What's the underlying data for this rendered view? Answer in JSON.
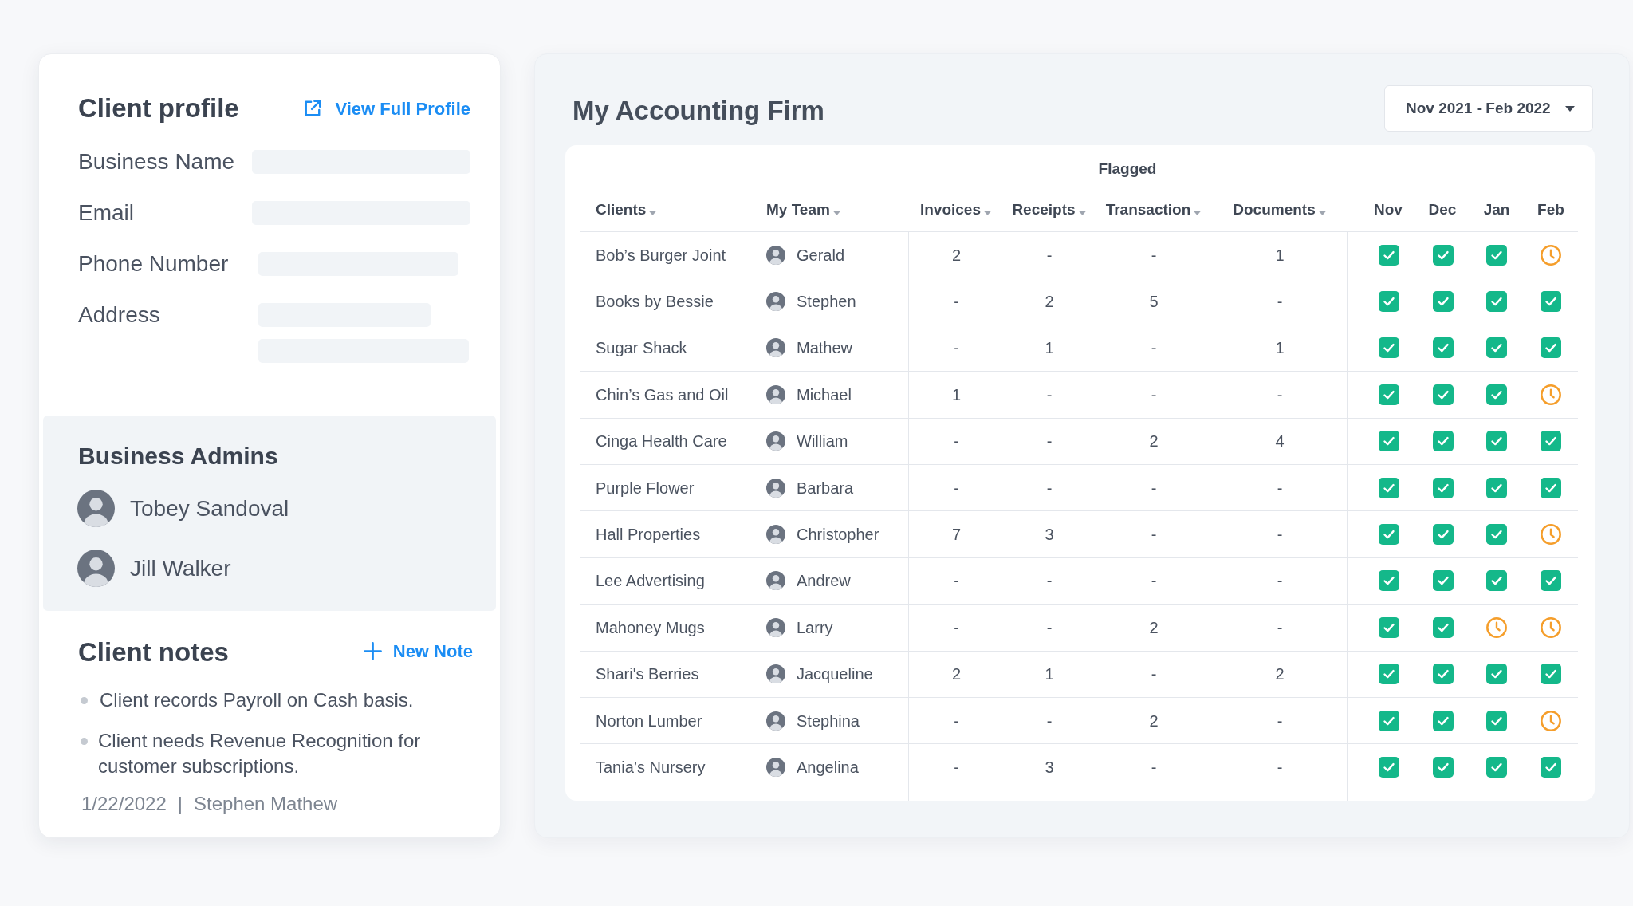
{
  "client_profile": {
    "title": "Client profile",
    "link": "View Full Profile",
    "fields": [
      {
        "label": "Business Name",
        "kind": "line"
      },
      {
        "label": "Email",
        "kind": "line"
      },
      {
        "label": "Phone Number",
        "kind": "line"
      },
      {
        "label": "Address",
        "kind": "address"
      }
    ]
  },
  "business_admins": {
    "title": "Business Admins",
    "people": [
      {
        "name": "Tobey Sandoval"
      },
      {
        "name": "Jill Walker"
      }
    ]
  },
  "client_notes": {
    "title": "Client notes",
    "action": "New Note",
    "notes": [
      "Client records Payroll on Cash basis.",
      "Client needs Revenue Recognition for customer subscriptions."
    ],
    "footer": {
      "date": "1/22/2022",
      "separator": "|",
      "author": "Stephen Mathew"
    }
  },
  "firm": {
    "title": "My Accounting Firm",
    "date_range": "Nov 2021 - Feb 2022",
    "group_label": "Flagged",
    "columns": [
      {
        "label": "Clients",
        "sortable": true
      },
      {
        "label": "My Team",
        "sortable": true
      },
      {
        "label": "Invoices",
        "sortable": true
      },
      {
        "label": "Receipts",
        "sortable": true
      },
      {
        "label": "Transaction",
        "sortable": true
      },
      {
        "label": "Documents",
        "sortable": true
      },
      {
        "label": "Nov",
        "sortable": false
      },
      {
        "label": "Dec",
        "sortable": false
      },
      {
        "label": "Jan",
        "sortable": false
      },
      {
        "label": "Feb",
        "sortable": false
      }
    ],
    "rows": [
      {
        "client": "Bob’s Burger Joint",
        "member": "Gerald",
        "flagged": [
          "2",
          "-",
          "-",
          "1"
        ],
        "months": [
          {
            "checked": true
          },
          {
            "checked": true
          },
          {
            "checked": true
          },
          {
            "checked": false
          }
        ]
      },
      {
        "client": "Books by Bessie",
        "member": "Stephen",
        "flagged": [
          "-",
          "2",
          "5",
          "-"
        ],
        "months": [
          {
            "checked": true
          },
          {
            "checked": true
          },
          {
            "checked": true
          },
          {
            "checked": true
          }
        ]
      },
      {
        "client": "Sugar Shack",
        "member": "Mathew",
        "flagged": [
          "-",
          "1",
          "-",
          "1"
        ],
        "months": [
          {
            "checked": true
          },
          {
            "checked": true
          },
          {
            "checked": true
          },
          {
            "checked": true
          }
        ]
      },
      {
        "client": "Chin’s Gas and Oil",
        "member": "Michael",
        "flagged": [
          "1",
          "-",
          "-",
          "-"
        ],
        "months": [
          {
            "checked": true
          },
          {
            "checked": true
          },
          {
            "checked": true
          },
          {
            "checked": false
          }
        ]
      },
      {
        "client": "Cinga Health Care",
        "member": "William",
        "flagged": [
          "-",
          "-",
          "2",
          "4"
        ],
        "months": [
          {
            "checked": true
          },
          {
            "checked": true
          },
          {
            "checked": true
          },
          {
            "checked": true
          }
        ]
      },
      {
        "client": "Purple Flower",
        "member": "Barbara",
        "flagged": [
          "-",
          "-",
          "-",
          "-"
        ],
        "months": [
          {
            "checked": true
          },
          {
            "checked": true
          },
          {
            "checked": true
          },
          {
            "checked": true
          }
        ]
      },
      {
        "client": "Hall Properties",
        "member": "Christopher",
        "flagged": [
          "7",
          "3",
          "-",
          "-"
        ],
        "months": [
          {
            "checked": true
          },
          {
            "checked": true
          },
          {
            "checked": true
          },
          {
            "checked": false
          }
        ]
      },
      {
        "client": "Lee Advertising",
        "member": "Andrew",
        "flagged": [
          "-",
          "-",
          "-",
          "-"
        ],
        "months": [
          {
            "checked": true
          },
          {
            "checked": true
          },
          {
            "checked": true
          },
          {
            "checked": true
          }
        ]
      },
      {
        "client": "Mahoney Mugs",
        "member": "Larry",
        "flagged": [
          "-",
          "-",
          "2",
          "-"
        ],
        "months": [
          {
            "checked": true
          },
          {
            "checked": true
          },
          {
            "checked": false
          },
          {
            "checked": false
          }
        ]
      },
      {
        "client": "Shari's Berries",
        "member": "Jacqueline",
        "flagged": [
          "2",
          "1",
          "-",
          "2"
        ],
        "months": [
          {
            "checked": true
          },
          {
            "checked": true
          },
          {
            "checked": true
          },
          {
            "checked": true
          }
        ]
      },
      {
        "client": "Norton Lumber",
        "member": "Stephina",
        "flagged": [
          "-",
          "-",
          "2",
          "-"
        ],
        "months": [
          {
            "checked": true
          },
          {
            "checked": true
          },
          {
            "checked": true
          },
          {
            "checked": false
          }
        ]
      },
      {
        "client": "Tania’s Nursery",
        "member": "Angelina",
        "flagged": [
          "-",
          "3",
          "-",
          "-"
        ],
        "months": [
          {
            "checked": true
          },
          {
            "checked": true
          },
          {
            "checked": true
          },
          {
            "checked": true
          }
        ]
      }
    ]
  }
}
